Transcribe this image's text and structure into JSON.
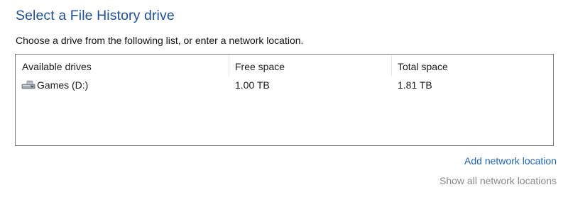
{
  "page": {
    "title": "Select a File History drive",
    "instructions": "Choose a drive from the following list, or enter a network location."
  },
  "drive_list": {
    "columns": {
      "drive": "Available drives",
      "free": "Free space",
      "total": "Total space"
    },
    "rows": [
      {
        "icon": "hard-drive-icon",
        "name": "Games (D:)",
        "free": "1.00 TB",
        "total": "1.81 TB"
      }
    ]
  },
  "links": {
    "add_network_location": "Add network location",
    "show_all_network_locations": "Show all network locations"
  },
  "colors": {
    "title": "#1e4f9c",
    "link": "#1e63b6",
    "link_disabled": "#8a8a8a",
    "list_border": "#7a7a7a"
  }
}
